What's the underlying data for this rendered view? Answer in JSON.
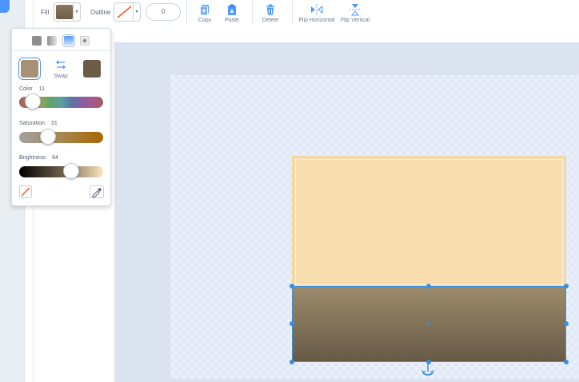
{
  "toolbar": {
    "fill_label": "Fill",
    "outline_label": "Outline",
    "outline_width": "0",
    "fill_color": "#6b5d48",
    "tools": [
      {
        "label": "Copy",
        "icon": "copy-icon"
      },
      {
        "label": "Paste",
        "icon": "paste-icon"
      },
      {
        "label": "Delete",
        "icon": "delete-icon"
      },
      {
        "label": "Flip Horizontal",
        "icon": "flip-horizontal-icon"
      },
      {
        "label": "Flip Vertical",
        "icon": "flip-vertical-icon"
      }
    ]
  },
  "fill_popover": {
    "fill_types": [
      "solid-fill-icon",
      "horizontal-gradient-icon",
      "vertical-gradient-icon",
      "radial-gradient-icon"
    ],
    "primary_color": "#a69172",
    "secondary_color": "#6b5d48",
    "swap_label": "Swap",
    "color": {
      "label": "Color",
      "value": "11"
    },
    "saturation": {
      "label": "Saturation",
      "value": "31"
    },
    "brightness": {
      "label": "Brightness",
      "value": "64"
    },
    "icons": [
      "no-fill-icon",
      "eyedropper-icon"
    ]
  },
  "canvas": {
    "shape_top_color": "#f8deaf",
    "shape_bottom_colors": [
      "#9c8b6c",
      "#675a46"
    ],
    "selection_color": "#3a8fe0"
  }
}
